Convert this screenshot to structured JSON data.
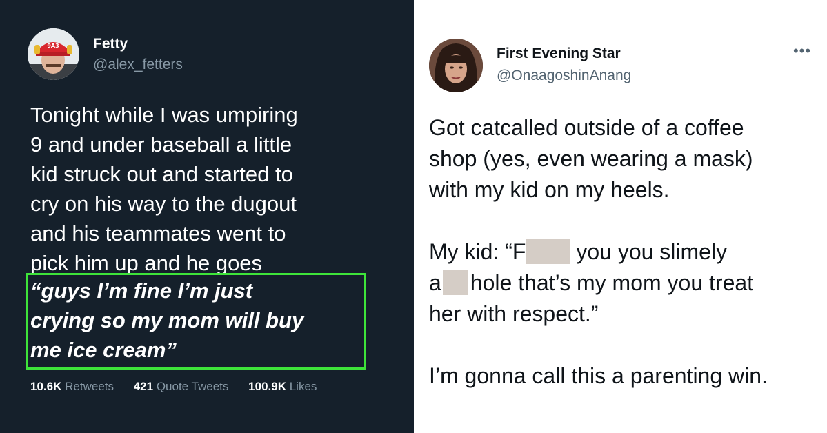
{
  "left_tweet": {
    "name": "Fetty",
    "handle": "@alex_fetters",
    "avatar_cap_text": "9A3",
    "lines": [
      "Tonight while I was umpiring",
      "9 and under baseball a little",
      "kid struck out and started to",
      "cry on his way to the dugout",
      "and his teammates went to",
      "pick him up and he goes"
    ],
    "quote_lines": [
      "“guys I’m fine I’m just",
      "crying so my mom will buy",
      "me ice cream”"
    ],
    "stats": {
      "retweets_count": "10.6K",
      "retweets_label": "Retweets",
      "quotes_count": "421",
      "quotes_label": "Quote Tweets",
      "likes_count": "100.9K",
      "likes_label": "Likes"
    },
    "highlight_color": "#3ee43a"
  },
  "right_tweet": {
    "name": "First Evening Star",
    "handle": "@OnaagoshinAnang",
    "more_icon": "more-horizontal-icon",
    "para1": [
      "Got catcalled outside of a coffee",
      "shop (yes, even wearing a mask)",
      "with my kid on my heels."
    ],
    "para2_line1_a": "My kid: “F",
    "para2_line1_b": " you you slimely",
    "para2_line2_a": "a",
    "para2_line2_b": "hole that’s my mom you treat",
    "para2_line3": "her with respect.”",
    "para3": "I’m gonna call this a parenting win."
  },
  "colors": {
    "dark_bg": "#15202b",
    "secondary_text_dark": "#8899a6",
    "secondary_text_light": "#536471",
    "redaction": "#d5cdc6"
  }
}
